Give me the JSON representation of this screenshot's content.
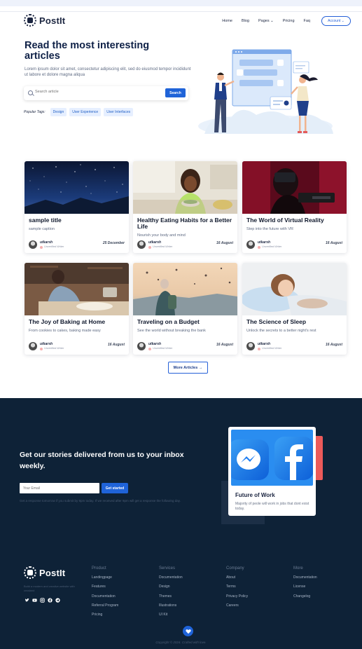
{
  "brand": {
    "name": "PostIt",
    "tagline": ""
  },
  "nav": {
    "home": "Home",
    "blog": "Blog",
    "pages": "Pages ⌄",
    "pricing": "Pricing",
    "faq": "Faq",
    "account": "Account ⌄"
  },
  "hero": {
    "title": "Read the most interesting articles",
    "description": "Lorem ipsum dolor sit amet, consectetur adipiscing elit, sed do eiusmod tempor incididunt ut labore et dolore magna aliqua",
    "search_placeholder": "Search article",
    "search_button": "Search",
    "popular_label": "Popular Tags:",
    "tags": [
      "Design",
      "User Experience",
      "User Interfaces"
    ]
  },
  "articles": [
    {
      "title": "sample title",
      "caption": "sample caption",
      "author": "utkarsh",
      "badge": "Unverified Writer",
      "date": "25 December"
    },
    {
      "title": "Healthy Eating Habits for a Better Life",
      "caption": "Nourish your body and mind",
      "author": "utkarsh",
      "badge": "Unverified Writer",
      "date": "16 August"
    },
    {
      "title": "The World of Virtual Reality",
      "caption": "Step into the future with VR",
      "author": "utkarsh",
      "badge": "Unverified Writer",
      "date": "16 August"
    },
    {
      "title": "The Joy of Baking at Home",
      "caption": "From cookies to cakes, baking made easy",
      "author": "utkarsh",
      "badge": "Unverified Writer",
      "date": "16 August"
    },
    {
      "title": "Traveling on a Budget",
      "caption": "See the world without breaking the bank",
      "author": "utkarsh",
      "badge": "Unverified Writer",
      "date": "16 August"
    },
    {
      "title": "The Science of Sleep",
      "caption": "Unlock the secrets to a better night's rest",
      "author": "utkarsh",
      "badge": "Unverified Writer",
      "date": "16 August"
    }
  ],
  "more_articles": "More Articles →",
  "newsletter": {
    "title": "Get our stories delivered from us to your inbox weekly.",
    "email_placeholder": "Your Email",
    "button": "Get started",
    "note": "Get a response tomorrow if you submit by 9pm today. If we received after 9pm will get a response the following day."
  },
  "feature_card": {
    "title": "Future of Work",
    "description": "Majority of peole will work in jobs that dont exist today."
  },
  "footer": {
    "description": "Build a modern and creative website with crealand",
    "columns": [
      {
        "heading": "Product",
        "items": [
          "Landingpage",
          "Features",
          "Documentation",
          "Referral Program",
          "Pricing"
        ]
      },
      {
        "heading": "Services",
        "items": [
          "Documentation",
          "Design",
          "Themes",
          "Illustrations",
          "UI Kit"
        ]
      },
      {
        "heading": "Company",
        "items": [
          "About",
          "Terms",
          "Privacy Policy",
          "Careers"
        ]
      },
      {
        "heading": "More",
        "items": [
          "Documentation",
          "License",
          "Changelog"
        ]
      }
    ],
    "social_icons": [
      "twitter-icon",
      "youtube-icon",
      "instagram-icon",
      "facebook-icon",
      "telegram-icon"
    ],
    "copyright": "Copyright © 2024. Crafted with love."
  },
  "colors": {
    "primary": "#1f63d8",
    "dark": "#0e2237",
    "heading": "#0f2147",
    "accent_red": "#ec5a5a"
  }
}
